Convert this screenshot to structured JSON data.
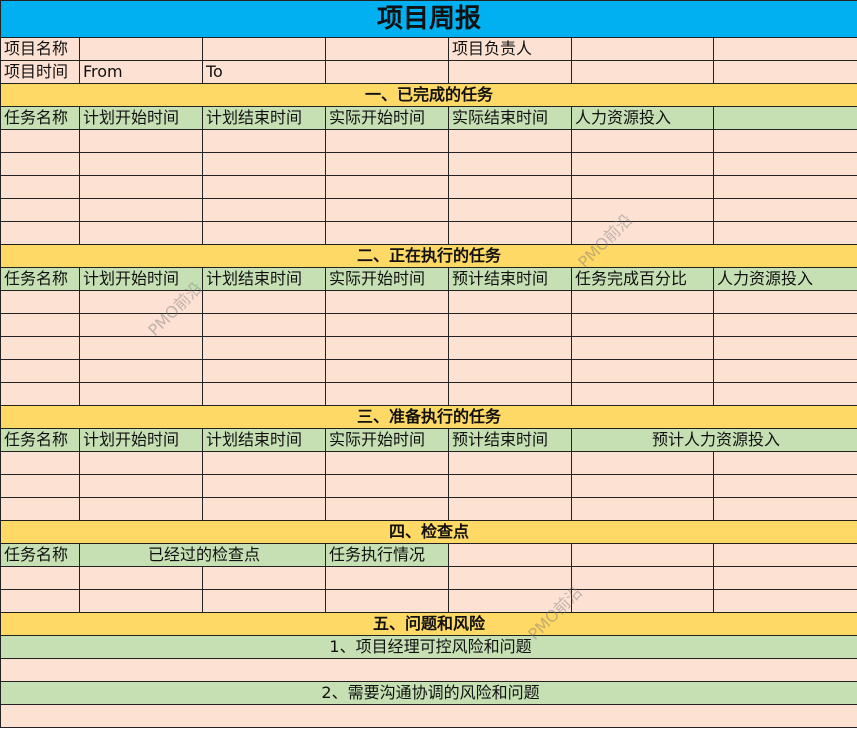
{
  "title": "项目周报",
  "header": {
    "project_name_label": "项目名称",
    "owner_label": "项目负责人",
    "time_label": "项目时间",
    "from_label": "From",
    "to_label": "To"
  },
  "sections": {
    "completed": {
      "title": "一、已完成的任务",
      "columns": [
        "任务名称",
        "计划开始时间",
        "计划结束时间",
        "实际开始时间",
        "实际结束时间",
        "人力资源投入",
        ""
      ]
    },
    "in_progress": {
      "title": "二、正在执行的任务",
      "columns": [
        "任务名称",
        "计划开始时间",
        "计划结束时间",
        "实际开始时间",
        "预计结束时间",
        "任务完成百分比",
        "人力资源投入"
      ]
    },
    "planned": {
      "title": "三、准备执行的任务",
      "columns": [
        "任务名称",
        "计划开始时间",
        "计划结束时间",
        "实际开始时间",
        "预计结束时间",
        "预计人力资源投入"
      ]
    },
    "checkpoints": {
      "title": "四、检查点",
      "columns": [
        "任务名称",
        "已经过的检查点",
        "任务执行情况"
      ]
    },
    "issues": {
      "title": "五、问题和风险",
      "sub1": "1、项目经理可控风险和问题",
      "sub2": "2、需要沟通协调的风险和问题"
    }
  },
  "watermark": "PMO前沿",
  "colors": {
    "title_bg": "#00b0f0",
    "section_bg": "#ffd966",
    "header_bg": "#c6e0b4",
    "cell_bg": "#fde2d3"
  }
}
